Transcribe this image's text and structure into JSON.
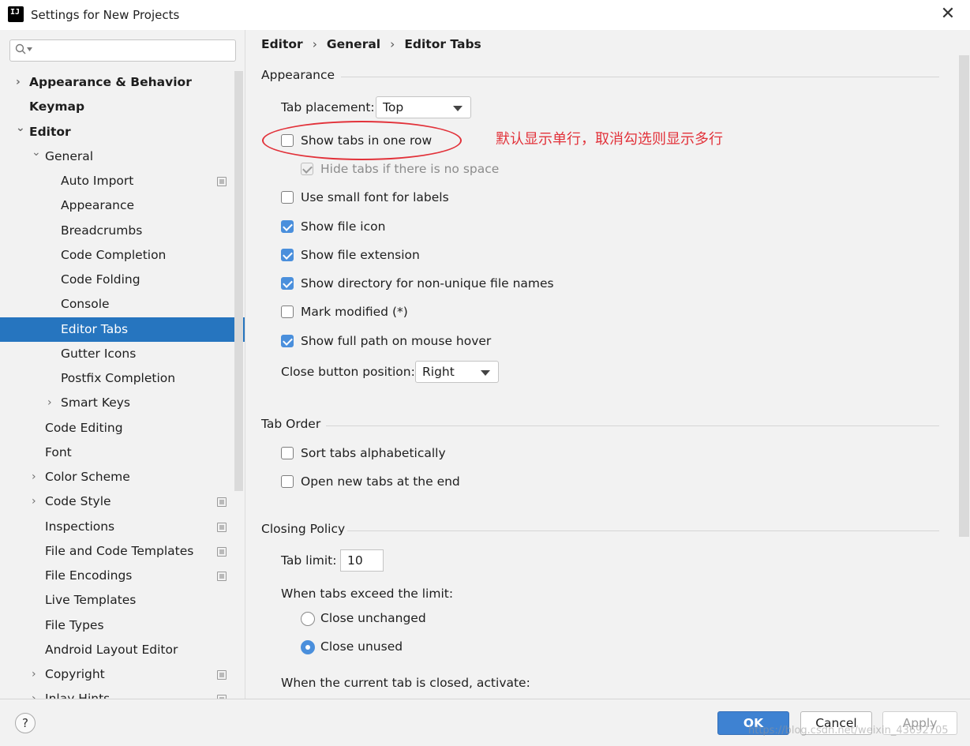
{
  "window": {
    "title": "Settings for New Projects",
    "close_glyph": "✕"
  },
  "sidebar": {
    "search": {
      "value": "",
      "placeholder": ""
    },
    "items": [
      {
        "label": "Appearance & Behavior",
        "bold": true,
        "chevron": "›",
        "selected": false
      },
      {
        "label": "Keymap",
        "bold": true,
        "chevron": "",
        "selected": false
      },
      {
        "label": "Editor",
        "bold": true,
        "chevron": "⌄",
        "selected": false
      },
      {
        "label": "General",
        "bold": false,
        "chevron": "⌄",
        "selected": false
      },
      {
        "label": "Auto Import",
        "bold": false,
        "chevron": "",
        "selected": false,
        "project_icon": true
      },
      {
        "label": "Appearance",
        "bold": false,
        "chevron": "",
        "selected": false
      },
      {
        "label": "Breadcrumbs",
        "bold": false,
        "chevron": "",
        "selected": false
      },
      {
        "label": "Code Completion",
        "bold": false,
        "chevron": "",
        "selected": false
      },
      {
        "label": "Code Folding",
        "bold": false,
        "chevron": "",
        "selected": false
      },
      {
        "label": "Console",
        "bold": false,
        "chevron": "",
        "selected": false
      },
      {
        "label": "Editor Tabs",
        "bold": false,
        "chevron": "",
        "selected": true
      },
      {
        "label": "Gutter Icons",
        "bold": false,
        "chevron": "",
        "selected": false
      },
      {
        "label": "Postfix Completion",
        "bold": false,
        "chevron": "",
        "selected": false
      },
      {
        "label": "Smart Keys",
        "bold": false,
        "chevron": "›",
        "selected": false
      },
      {
        "label": "Code Editing",
        "bold": false,
        "chevron": "",
        "selected": false
      },
      {
        "label": "Font",
        "bold": false,
        "chevron": "",
        "selected": false
      },
      {
        "label": "Color Scheme",
        "bold": false,
        "chevron": "›",
        "selected": false
      },
      {
        "label": "Code Style",
        "bold": false,
        "chevron": "›",
        "selected": false,
        "project_icon": true
      },
      {
        "label": "Inspections",
        "bold": false,
        "chevron": "",
        "selected": false,
        "project_icon": true
      },
      {
        "label": "File and Code Templates",
        "bold": false,
        "chevron": "",
        "selected": false,
        "project_icon": true
      },
      {
        "label": "File Encodings",
        "bold": false,
        "chevron": "",
        "selected": false,
        "project_icon": true
      },
      {
        "label": "Live Templates",
        "bold": false,
        "chevron": "",
        "selected": false
      },
      {
        "label": "File Types",
        "bold": false,
        "chevron": "",
        "selected": false
      },
      {
        "label": "Android Layout Editor",
        "bold": false,
        "chevron": "",
        "selected": false
      },
      {
        "label": "Copyright",
        "bold": false,
        "chevron": "›",
        "selected": false,
        "project_icon": true
      },
      {
        "label": "Inlay Hints",
        "bold": false,
        "chevron": "›",
        "selected": false,
        "project_icon": true
      }
    ]
  },
  "breadcrumb": [
    "Editor",
    "General",
    "Editor Tabs"
  ],
  "breadcrumb_separator": "›",
  "appearance": {
    "section_title": "Appearance",
    "tab_placement_label": "Tab placement:",
    "tab_placement_value": "Top",
    "options": [
      {
        "label": "Show tabs in one row",
        "checked": false,
        "disabled": false
      },
      {
        "label": "Hide tabs if there is no space",
        "checked": true,
        "disabled": true
      },
      {
        "label": "Use small font for labels",
        "checked": false,
        "disabled": false
      },
      {
        "label": "Show file icon",
        "checked": true,
        "disabled": false
      },
      {
        "label": "Show file extension",
        "checked": true,
        "disabled": false
      },
      {
        "label": "Show directory for non-unique file names",
        "checked": true,
        "disabled": false
      },
      {
        "label": "Mark modified (*)",
        "checked": false,
        "disabled": false
      },
      {
        "label": "Show full path on mouse hover",
        "checked": true,
        "disabled": false
      }
    ],
    "close_button_label": "Close button position:",
    "close_button_value": "Right"
  },
  "annotation": {
    "note": "默认显示单行，取消勾选则显示多行",
    "color": "#e2323a"
  },
  "tab_order": {
    "section_title": "Tab Order",
    "options": [
      {
        "label": "Sort tabs alphabetically",
        "checked": false
      },
      {
        "label": "Open new tabs at the end",
        "checked": false
      }
    ]
  },
  "closing_policy": {
    "section_title": "Closing Policy",
    "tab_limit_label": "Tab limit:",
    "tab_limit_value": "10",
    "exceed_label": "When tabs exceed the limit:",
    "exceed_options": [
      {
        "label": "Close unchanged",
        "selected": false
      },
      {
        "label": "Close unused",
        "selected": true
      }
    ],
    "closed_label": "When the current tab is closed, activate:"
  },
  "footer": {
    "help": "?",
    "ok": "OK",
    "cancel": "Cancel",
    "apply": "Apply",
    "watermark": "https://blog.csdn.net/weixin_43692705"
  },
  "colors": {
    "selection": "#2675bf",
    "checkbox_on": "#4a8fdc",
    "ok_button": "#3e82d2"
  }
}
